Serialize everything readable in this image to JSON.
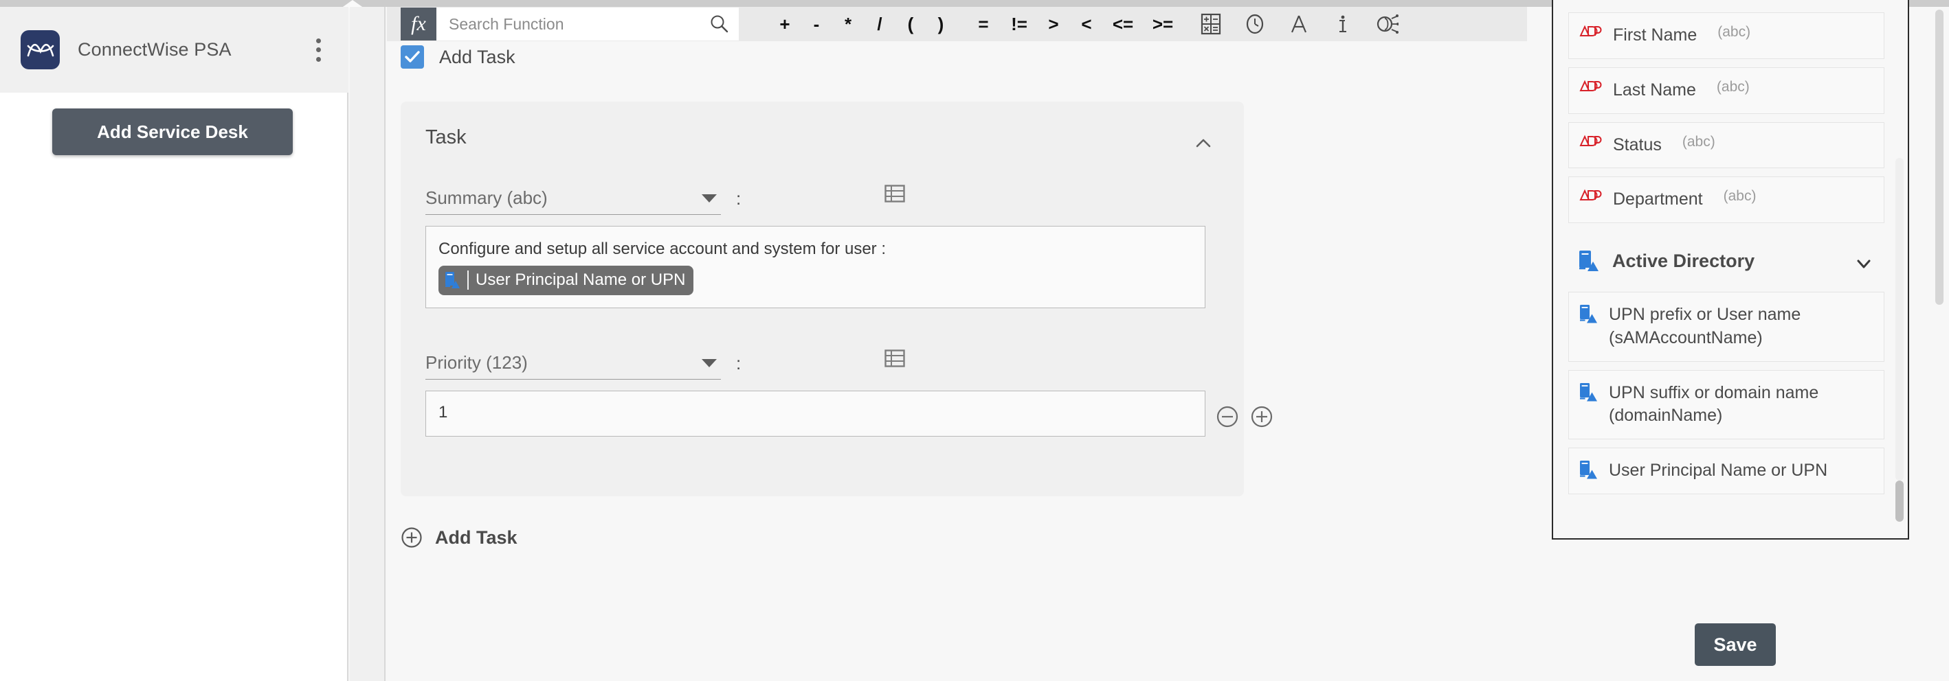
{
  "app": {
    "name": "ConnectWise PSA",
    "logo_color": "#2b3a67",
    "menu_icon": "kebab-menu-icon"
  },
  "sidebar": {
    "add_service_desk_label": "Add Service Desk"
  },
  "toolbar": {
    "fx_label": "fx",
    "search_placeholder": "Search Function",
    "search_value": "",
    "search_icon": "search-icon",
    "operators": [
      "+",
      "-",
      "*",
      "/",
      "(",
      ")",
      "=",
      "!=",
      ">",
      "<",
      "<=",
      ">="
    ],
    "icons": [
      {
        "name": "calculator-icon"
      },
      {
        "name": "clock-icon"
      },
      {
        "name": "text-format-icon"
      },
      {
        "name": "info-icon"
      },
      {
        "name": "logic-gear-icon"
      }
    ]
  },
  "main": {
    "add_task_checkbox_label": "Add Task",
    "add_task_checked": true,
    "card": {
      "title": "Task",
      "collapse_icon": "chevron-up-icon",
      "fields": [
        {
          "label": "Summary (abc)",
          "separator": ":",
          "grid_icon": "table-grid-icon",
          "value_text": "Configure and setup all service account and system for user :",
          "token": "User Principal Name or UPN",
          "token_icon": "active-directory-icon"
        },
        {
          "label": "Priority (123)",
          "separator": ":",
          "grid_icon": "table-grid-icon",
          "value_text": "1",
          "stepper_minus_icon": "minus-circle-icon",
          "stepper_plus_icon": "plus-circle-icon"
        }
      ]
    },
    "add_task_link": {
      "label": "Add Task",
      "icon": "plus-circle-icon"
    }
  },
  "picker": {
    "items": [
      {
        "label": "First Name",
        "type": "(abc)",
        "icon": "adp-icon"
      },
      {
        "label": "Last Name",
        "type": "(abc)",
        "icon": "adp-icon"
      },
      {
        "label": "Status",
        "type": "(abc)",
        "icon": "adp-icon"
      },
      {
        "label": "Department",
        "type": "(abc)",
        "icon": "adp-icon"
      }
    ],
    "group": {
      "label": "Active Directory",
      "icon": "active-directory-icon",
      "chevron": "chevron-down-icon"
    },
    "group_items": [
      {
        "label": "UPN prefix or User name (sAMAccountName)",
        "icon": "active-directory-icon"
      },
      {
        "label": "UPN suffix or domain name (domainName)",
        "icon": "active-directory-icon"
      },
      {
        "label": "User Principal Name or UPN",
        "icon": "active-directory-icon"
      }
    ]
  },
  "footer": {
    "save_label": "Save"
  },
  "colors": {
    "accent_blue": "#4a90d9",
    "dark_slate": "#49545e",
    "adp_red": "#d8222a",
    "ad_blue": "#2f7ed8"
  }
}
